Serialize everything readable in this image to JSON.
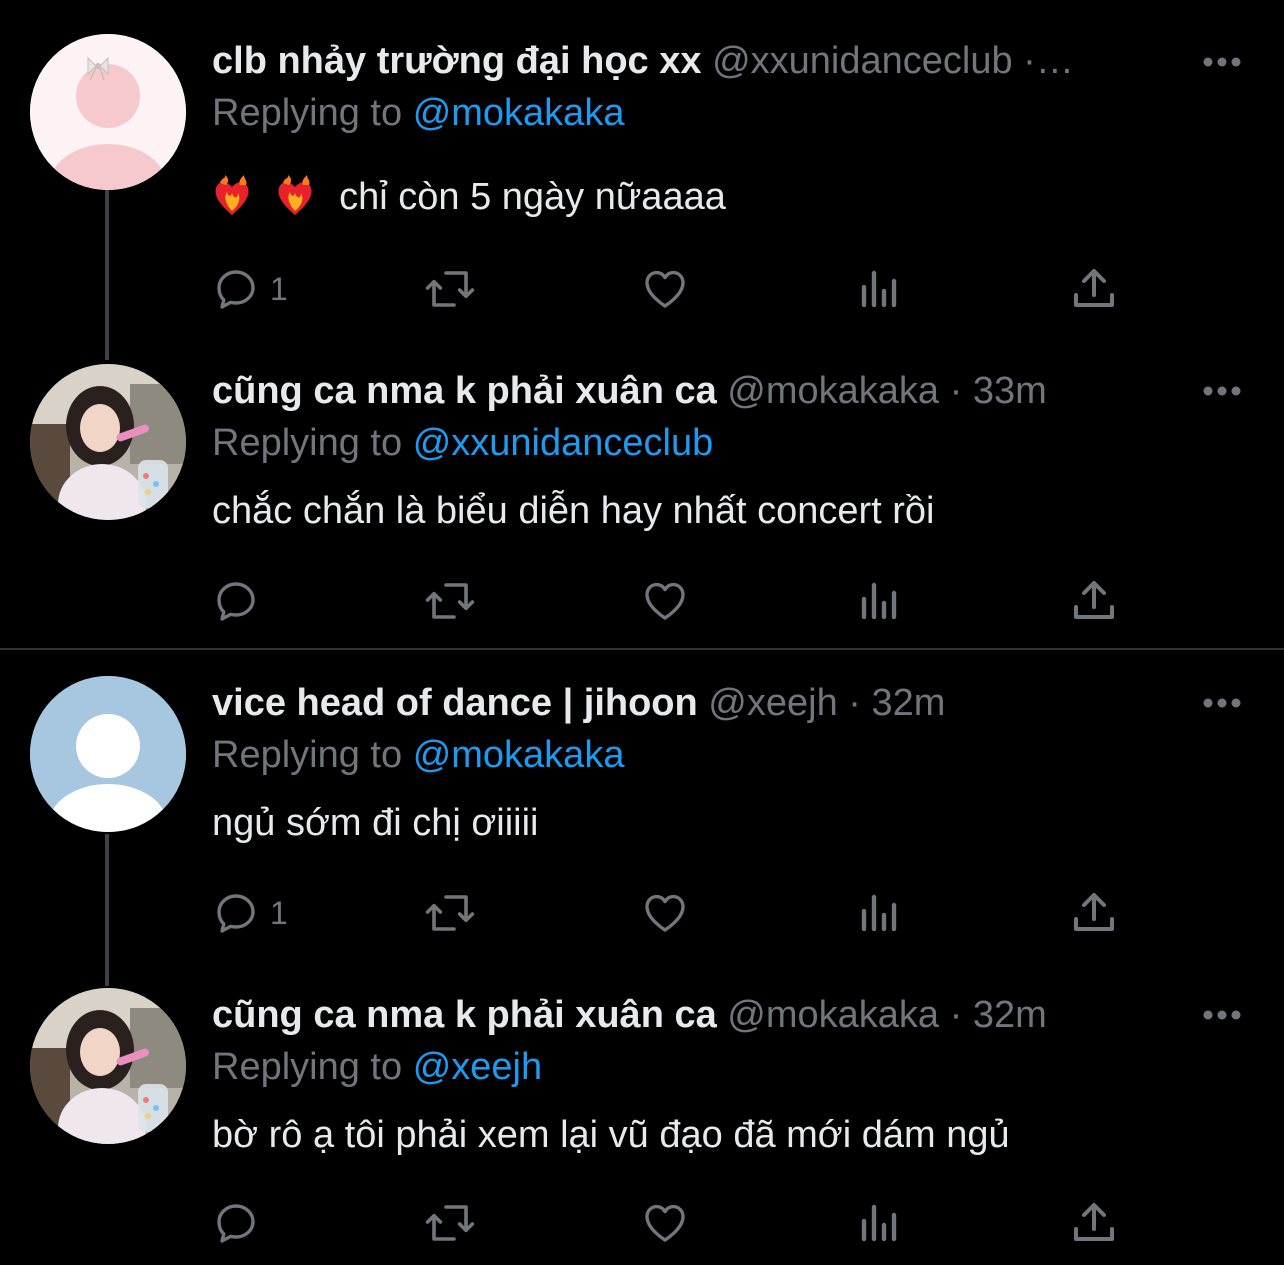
{
  "tweets": [
    {
      "name": "clb nhảy trường đại học xx",
      "handle": "@xxunidanceclub",
      "time_sep": "·…",
      "replying_label": "Replying to",
      "replying_to": "@mokakaka",
      "text": "chỉ còn 5 ngày nữaaaa",
      "emoji": "❤️‍🔥 ❤️‍🔥",
      "reply_count": "1",
      "avatar": "pink-bow-avatar"
    },
    {
      "name": "cũng ca nma k phải xuân ca",
      "handle": "@mokakaka",
      "time_sep": "· 33m",
      "replying_label": "Replying to",
      "replying_to": "@xxunidanceclub",
      "text": "chắc chắn là biểu diễn hay nhất concert rồi",
      "reply_count": "",
      "avatar": "photo-avatar"
    },
    {
      "name": "vice head of dance | jihoon",
      "handle": "@xeejh",
      "time_sep": "· 32m",
      "replying_label": "Replying to",
      "replying_to": "@mokakaka",
      "text": "ngủ sớm đi chị ơiiiii",
      "reply_count": "1",
      "avatar": "default-avatar"
    },
    {
      "name": "cũng ca nma k phải xuân ca",
      "handle": "@mokakaka",
      "time_sep": "· 32m",
      "replying_label": "Replying to",
      "replying_to": "@xeejh",
      "text": "bờ rô ạ tôi phải xem lại vũ đạo đã mới dám ngủ",
      "reply_count": "",
      "avatar": "photo-avatar"
    }
  ],
  "colors": {
    "background": "#000000",
    "text": "#e7e9ea",
    "muted": "#71767b",
    "link": "#1d9bf0",
    "divider": "#2f3336"
  },
  "icons": [
    "reply-icon",
    "retweet-icon",
    "like-icon",
    "views-icon",
    "share-icon",
    "more-icon"
  ]
}
